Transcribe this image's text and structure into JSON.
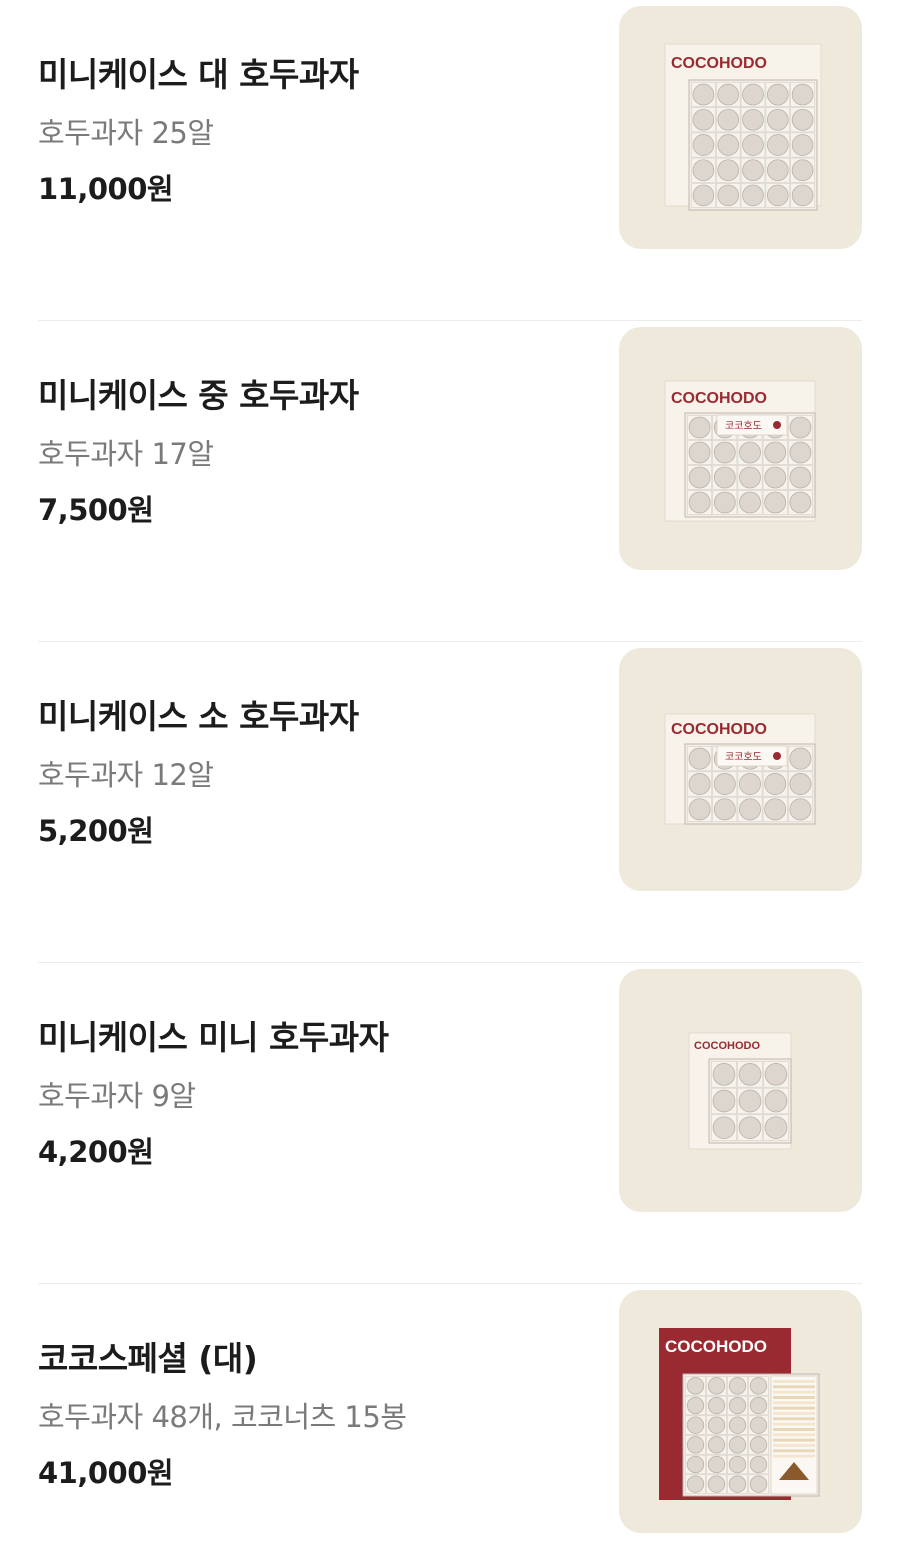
{
  "colors": {
    "thumb_bg": "#efe9dc",
    "brand_red": "#9a2a32",
    "box_cream": "#f7f3ea",
    "walnut_cake": "#d9d3cc",
    "text_primary": "#1c1c1c",
    "text_secondary": "#7a7a7a"
  },
  "items": [
    {
      "name": "미니케이스 대 호두과자",
      "description": "호두과자 25알",
      "price": "11,000원",
      "image": {
        "brand": "COCOHODO",
        "rows": 5,
        "cols": 5,
        "box_style": "cream"
      }
    },
    {
      "name": "미니케이스 중 호두과자",
      "description": "호두과자 17알",
      "price": "7,500원",
      "image": {
        "brand": "COCOHODO",
        "label": "코코호도",
        "rows": 4,
        "cols": 5,
        "box_style": "cream"
      }
    },
    {
      "name": "미니케이스 소 호두과자",
      "description": "호두과자 12알",
      "price": "5,200원",
      "image": {
        "brand": "COCOHODO",
        "label": "코코호도",
        "rows": 3,
        "cols": 5,
        "box_style": "cream"
      }
    },
    {
      "name": "미니케이스 미니 호두과자",
      "description": "호두과자 9알",
      "price": "4,200원",
      "image": {
        "brand": "COCOHODO",
        "rows": 3,
        "cols": 3,
        "box_style": "cream"
      }
    },
    {
      "name": "코코스페셜 (대)",
      "description": "호두과자 48개, 코코너츠 15봉",
      "price": "41,000원",
      "image": {
        "brand": "COCOHODO",
        "rows": 6,
        "cols": 4,
        "box_style": "red"
      }
    }
  ]
}
